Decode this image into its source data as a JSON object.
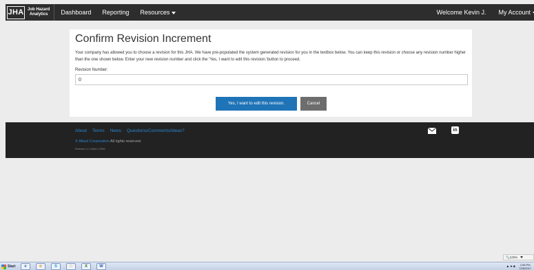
{
  "navbar": {
    "brand_abbr": "JHA",
    "brand_line1": "Job Hazard",
    "brand_line2": "Analytics",
    "links": [
      "Dashboard",
      "Reporting",
      "Resources"
    ],
    "welcome": "Welcome Kevin J.",
    "account": "My Account"
  },
  "dialog": {
    "title": "Confirm Revision Increment",
    "description": "Your company has allowed you to choose a revision for this JHA. We have pre-populated the system generated revision for you in the textbox below. You can keep this revision or choose any revision number higher than the one shown below. Enter your new revision number and click the 'Yes, I want to edit this revision.'button to proceed.",
    "field_label": "Revision Number:",
    "revision_value": "0",
    "confirm_label": "Yes, I want to edit this revision.",
    "cancel_label": "Cancel"
  },
  "footer": {
    "links": [
      "About",
      "Terms",
      "News",
      "Questions/Comments/Ideas?"
    ],
    "copyright_corp": "© Allard Corporation",
    "copyright_rest": " All rights reserved.",
    "release": "Release 4.1.6384.17555",
    "linkedin_glyph": "in"
  },
  "zoom_level": "125%",
  "taskbar": {
    "start_label": "Start",
    "clock_time": "2:58 PM",
    "clock_date": "7/26/2017"
  },
  "colors": {
    "nav_bg": "#2d2d2d",
    "primary": "#1f73b7",
    "cancel": "#6d6d6d",
    "footer_bg": "#222222",
    "footer_link": "#2a86d1"
  }
}
